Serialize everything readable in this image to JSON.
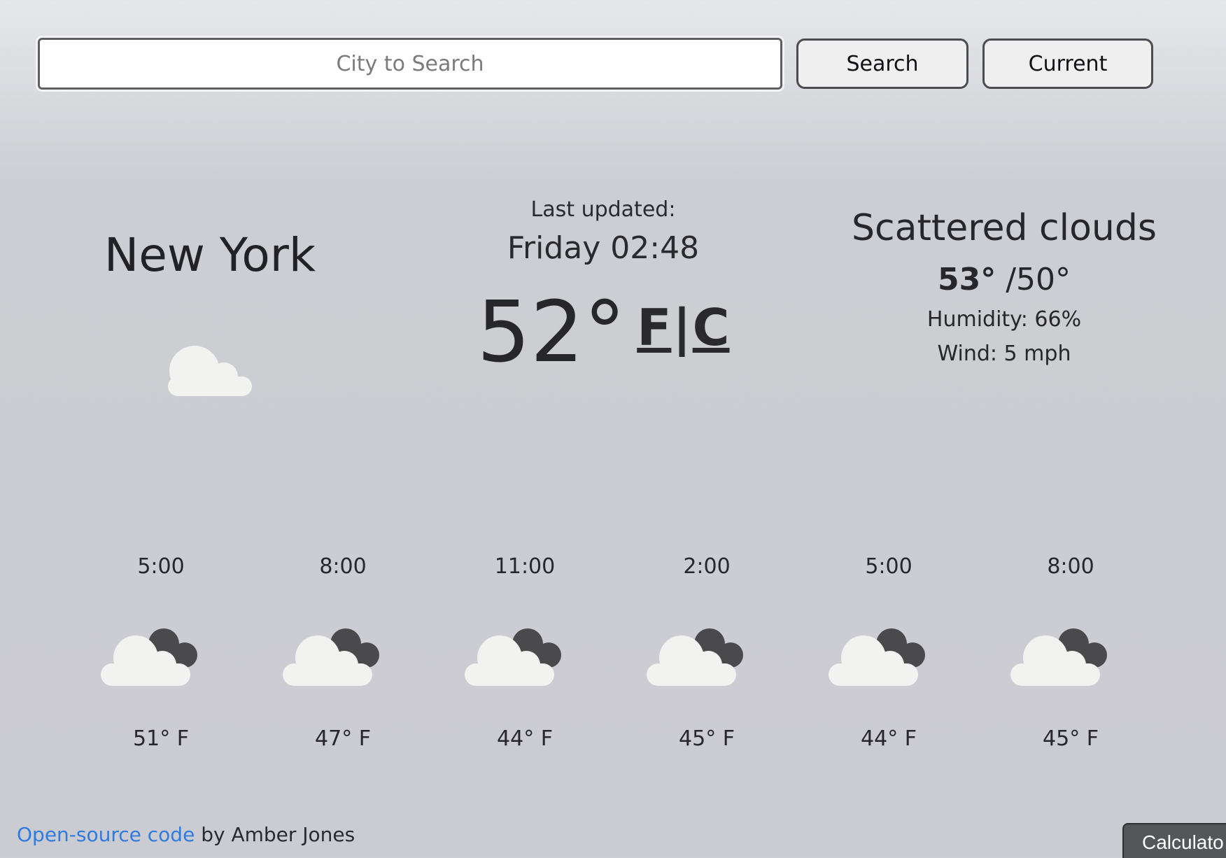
{
  "search": {
    "placeholder": "City to Search",
    "search_label": "Search",
    "current_label": "Current"
  },
  "current": {
    "city": "New York",
    "last_updated_label": "Last updated:",
    "last_updated_time": "Friday 02:48",
    "temperature": "52°",
    "unit_f": "F",
    "unit_separator": "|",
    "unit_c": "C",
    "description": "Scattered clouds",
    "high": "53°",
    "low": "/50°",
    "humidity": "Humidity: 66%",
    "wind": "Wind: 5 mph",
    "icon": "cloud-icon"
  },
  "forecast": [
    {
      "time": "5:00",
      "temp": "51° F",
      "icon": "cloudy-icon"
    },
    {
      "time": "8:00",
      "temp": "47° F",
      "icon": "cloudy-icon"
    },
    {
      "time": "11:00",
      "temp": "44° F",
      "icon": "cloudy-icon"
    },
    {
      "time": "2:00",
      "temp": "45° F",
      "icon": "cloudy-icon"
    },
    {
      "time": "5:00",
      "temp": "44° F",
      "icon": "cloudy-icon"
    },
    {
      "time": "8:00",
      "temp": "45° F",
      "icon": "cloudy-icon"
    }
  ],
  "footer": {
    "link_text": "Open-source code",
    "credit": " by Amber Jones"
  },
  "calculator_tab": "Calculato",
  "colors": {
    "link": "#2f7be0",
    "cloud_light": "#f2f2f0",
    "cloud_dark": "#4a4a4d"
  }
}
